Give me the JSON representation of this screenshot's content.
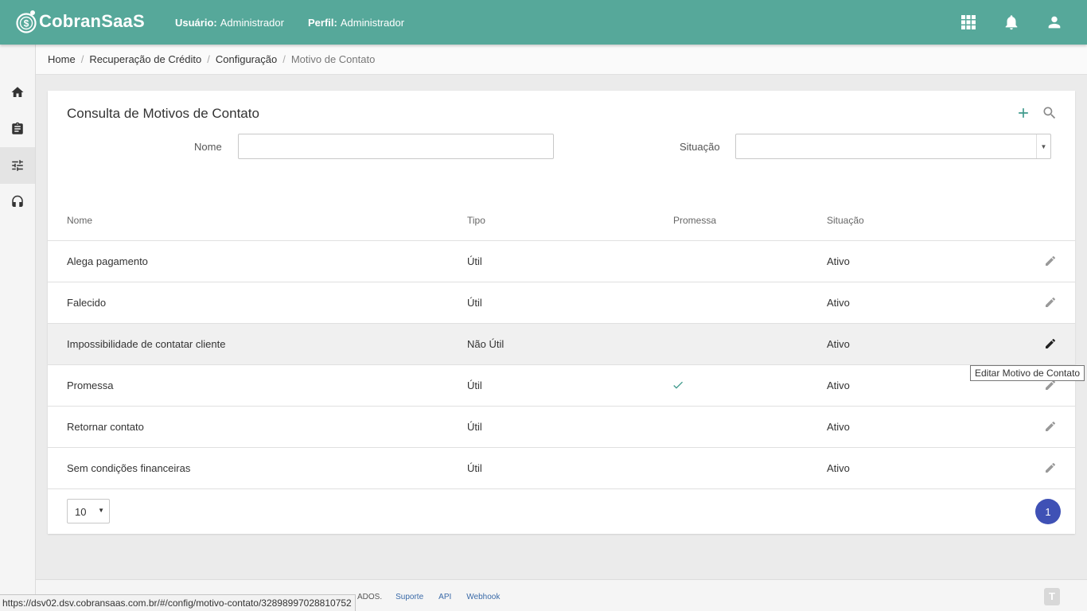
{
  "app": {
    "brand": "CobranSaaS",
    "user_label": "Usuário:",
    "user_value": "Administrador",
    "profile_label": "Perfil:",
    "profile_value": "Administrador",
    "accent_color": "#56a89a",
    "icons": [
      "apps-grid-icon",
      "bell-icon",
      "account-icon"
    ]
  },
  "sidebar": {
    "items": [
      {
        "name": "home",
        "icon": "home-icon"
      },
      {
        "name": "clipboard",
        "icon": "clipboard-icon"
      },
      {
        "name": "settings",
        "icon": "tune-icon",
        "active": true
      },
      {
        "name": "support",
        "icon": "headset-icon"
      }
    ]
  },
  "breadcrumb": [
    "Home",
    "Recuperação de Crédito",
    "Configuração",
    "Motivo de Contato"
  ],
  "main": {
    "title": "Consulta de Motivos de Contato",
    "filters": {
      "nome_label": "Nome",
      "nome_value": "",
      "situacao_label": "Situação",
      "situacao_value": ""
    },
    "columns": [
      "Nome",
      "Tipo",
      "Promessa",
      "Situação"
    ],
    "rows": [
      {
        "nome": "Alega pagamento",
        "tipo": "Útil",
        "promessa": false,
        "situacao": "Ativo"
      },
      {
        "nome": "Falecido",
        "tipo": "Útil",
        "promessa": false,
        "situacao": "Ativo"
      },
      {
        "nome": "Impossibilidade de contatar cliente",
        "tipo": "Não Útil",
        "promessa": false,
        "situacao": "Ativo"
      },
      {
        "nome": "Promessa",
        "tipo": "Útil",
        "promessa": true,
        "situacao": "Ativo"
      },
      {
        "nome": "Retornar contato",
        "tipo": "Útil",
        "promessa": false,
        "situacao": "Ativo"
      },
      {
        "nome": "Sem condições financeiras",
        "tipo": "Útil",
        "promessa": false,
        "situacao": "Ativo"
      }
    ],
    "page_size": "10",
    "current_page": "1",
    "tooltip": "Editar Motivo de Contato"
  },
  "footer": {
    "copyright_tail": "ADOS.",
    "links": [
      "Suporte",
      "API",
      "Webhook"
    ]
  },
  "status_url": "https://dsv02.dsv.cobransaas.com.br/#/config/motivo-contato/32898997028810752"
}
